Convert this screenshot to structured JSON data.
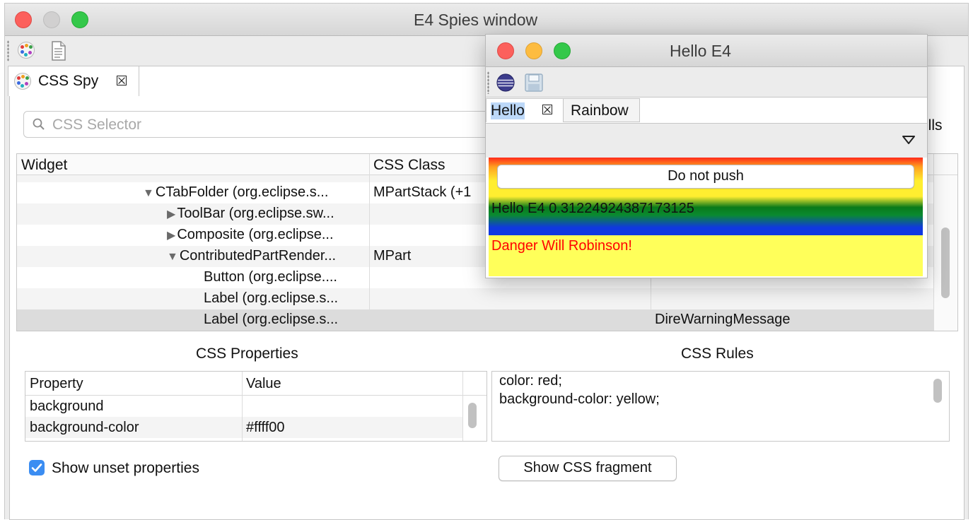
{
  "main_window": {
    "title": "E4 Spies window",
    "part_tab": {
      "label": "CSS Spy"
    },
    "search": {
      "placeholder": "CSS Selector"
    },
    "shells_label_fragment": "ells",
    "tree": {
      "columns": [
        "Widget",
        "CSS Class",
        ""
      ],
      "rows": [
        {
          "widget": "CTabFolder (org.eclipse.s...",
          "css_class": "MPartStack (+1",
          "third": "",
          "arrow": "▼"
        },
        {
          "widget": "ToolBar (org.eclipse.sw...",
          "css_class": "",
          "third": "",
          "arrow": "▶"
        },
        {
          "widget": "Composite (org.eclipse...",
          "css_class": "",
          "third": "",
          "arrow": "▶"
        },
        {
          "widget": "ContributedPartRender...",
          "css_class": "MPart",
          "third": "",
          "arrow": "▼"
        },
        {
          "widget": "Button (org.eclipse....",
          "css_class": "",
          "third": "",
          "arrow": ""
        },
        {
          "widget": "Label (org.eclipse.s...",
          "css_class": "",
          "third": "",
          "arrow": ""
        },
        {
          "widget": "Label (org.eclipse.s...",
          "css_class": "",
          "third": "DireWarningMessage",
          "arrow": ""
        }
      ]
    },
    "css_properties": {
      "title": "CSS Properties",
      "columns": [
        "Property",
        "Value"
      ],
      "rows": [
        {
          "property": "background",
          "value": ""
        },
        {
          "property": "background-color",
          "value": "#ffff00"
        }
      ]
    },
    "css_rules": {
      "title": "CSS Rules",
      "lines": [
        "color: red;",
        "background-color: yellow;"
      ]
    },
    "show_unset": {
      "label": "Show unset properties",
      "checked": true
    },
    "show_fragment_button": "Show CSS fragment"
  },
  "hello_window": {
    "title": "Hello E4",
    "tabs": [
      {
        "label": "Hello",
        "selected": true
      },
      {
        "label": "Rainbow",
        "selected": false
      }
    ],
    "do_not_push_button": "Do not push",
    "hello_label": "Hello E4 0.31224924387173125",
    "danger_label": "Danger Will Robinson!"
  },
  "colors": {
    "accent": "#3b8df2",
    "traffic_red": "#fc605c",
    "traffic_yellow": "#fdbc40",
    "traffic_green": "#34c84a",
    "danger_text": "#ff0000",
    "warning_background": "#ffff00"
  },
  "icons": [
    "palette-icon",
    "document-icon",
    "close-tab-icon",
    "search-icon",
    "globe-icon",
    "save-icon",
    "dropdown-chevron-icon",
    "checkbox-checked-icon"
  ]
}
